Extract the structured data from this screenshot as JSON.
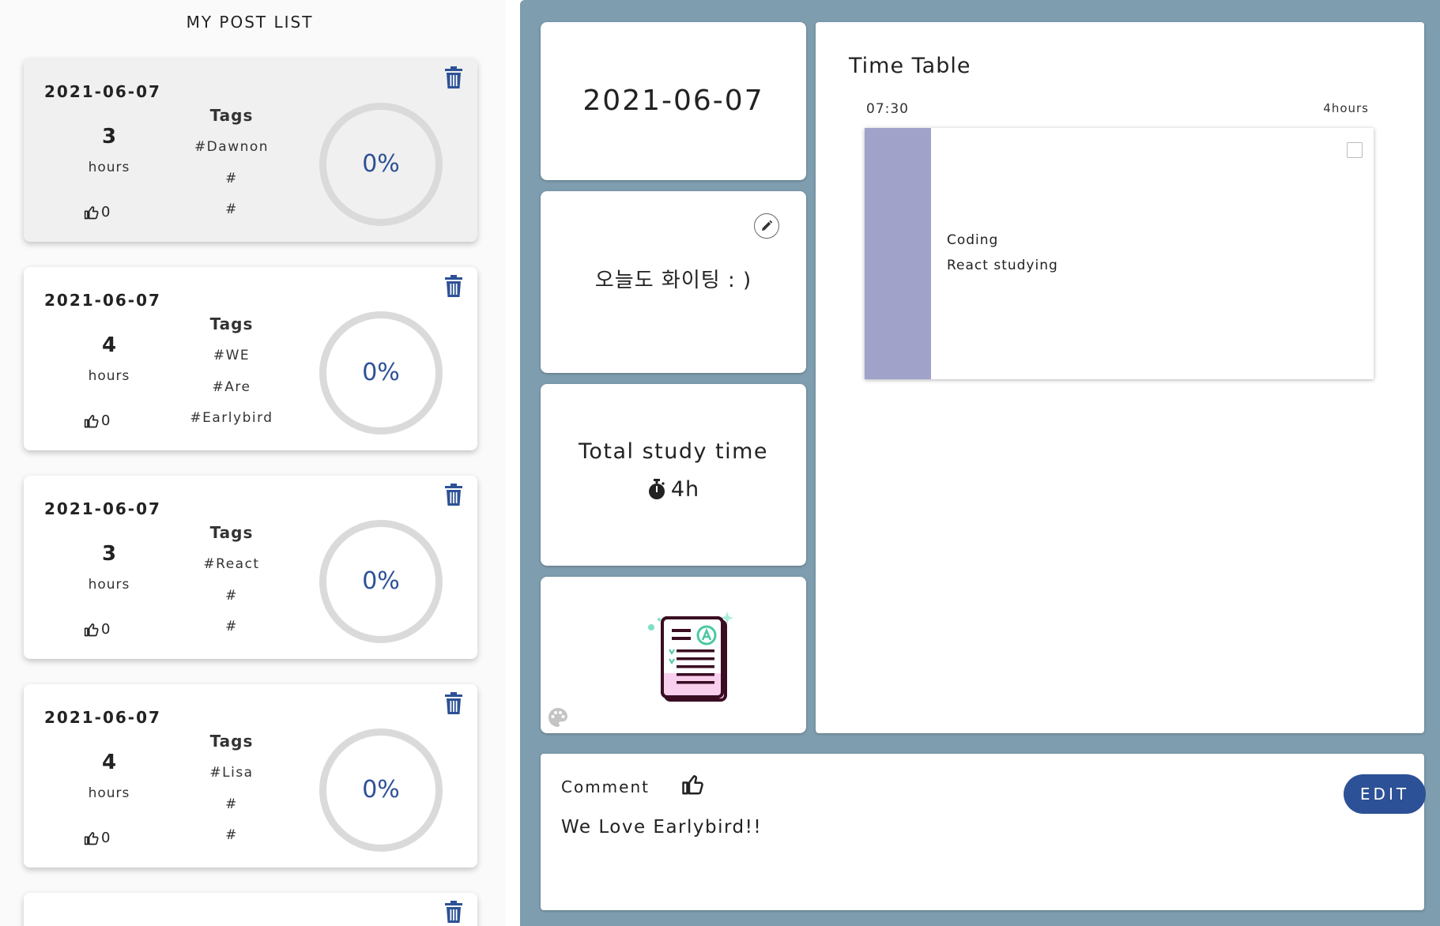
{
  "sidebar": {
    "title": "MY POST LIST",
    "hours_label": "hours",
    "tags_title": "Tags",
    "posts": [
      {
        "date": "2021-06-07",
        "hours": "3",
        "likes": "0",
        "tags": [
          "#Dawnon",
          "#",
          "#"
        ],
        "percent": "0%",
        "progress": 0,
        "selected": true
      },
      {
        "date": "2021-06-07",
        "hours": "4",
        "likes": "0",
        "tags": [
          "#WE",
          "#Are",
          "#Earlybird"
        ],
        "percent": "0%",
        "progress": 0,
        "selected": false
      },
      {
        "date": "2021-06-07",
        "hours": "3",
        "likes": "0",
        "tags": [
          "#React",
          "#",
          "#"
        ],
        "percent": "0%",
        "progress": 0,
        "selected": false
      },
      {
        "date": "2021-06-07",
        "hours": "4",
        "likes": "0",
        "tags": [
          "#Lisa",
          "#",
          "#"
        ],
        "percent": "0%",
        "progress": 0,
        "selected": false
      }
    ]
  },
  "detail": {
    "date": "2021-06-07",
    "motto": "오늘도 화이팅 : )",
    "study": {
      "title": "Total study time",
      "value": "4h"
    },
    "timetable": {
      "title": "Time Table",
      "start_time": "07:30",
      "duration": "4hours",
      "entry": {
        "category": "Coding",
        "description": "React studying",
        "color": "#a0a2c9",
        "checked": false
      }
    },
    "comment": {
      "label": "Comment",
      "text": "We Love Earlybird!!",
      "edit_label": "EDIT"
    }
  },
  "colors": {
    "accent": "#2d5196",
    "panel_bg": "#7e9dae",
    "ring": "#dadada"
  }
}
